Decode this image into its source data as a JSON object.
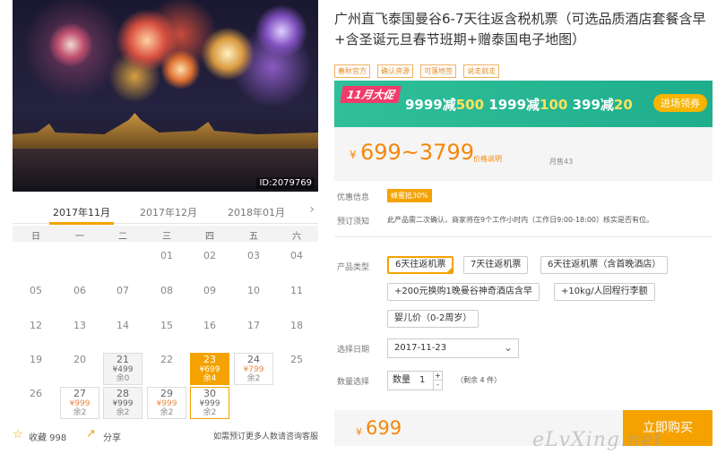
{
  "hero": {
    "image_id": "ID:2079769"
  },
  "calendar": {
    "months": [
      "2017年11月",
      "2017年12月",
      "2018年01月"
    ],
    "active_month": 0,
    "next_icon": "chevron-right-icon",
    "weekdays": [
      "日",
      "一",
      "二",
      "三",
      "四",
      "五",
      "六"
    ],
    "days": [
      {
        "n": "01",
        "col": 3,
        "row": 0
      },
      {
        "n": "02",
        "col": 4,
        "row": 0
      },
      {
        "n": "03",
        "col": 5,
        "row": 0
      },
      {
        "n": "04",
        "col": 6,
        "row": 0
      },
      {
        "n": "05",
        "col": 0,
        "row": 1
      },
      {
        "n": "06",
        "col": 1,
        "row": 1
      },
      {
        "n": "07",
        "col": 2,
        "row": 1
      },
      {
        "n": "08",
        "col": 3,
        "row": 1
      },
      {
        "n": "09",
        "col": 4,
        "row": 1
      },
      {
        "n": "10",
        "col": 5,
        "row": 1
      },
      {
        "n": "11",
        "col": 6,
        "row": 1
      },
      {
        "n": "12",
        "col": 0,
        "row": 2
      },
      {
        "n": "13",
        "col": 1,
        "row": 2
      },
      {
        "n": "14",
        "col": 2,
        "row": 2
      },
      {
        "n": "15",
        "col": 3,
        "row": 2
      },
      {
        "n": "16",
        "col": 4,
        "row": 2
      },
      {
        "n": "17",
        "col": 5,
        "row": 2
      },
      {
        "n": "18",
        "col": 6,
        "row": 2
      },
      {
        "n": "19",
        "col": 0,
        "row": 3
      },
      {
        "n": "20",
        "col": 1,
        "row": 3
      },
      {
        "n": "21",
        "col": 2,
        "row": 3,
        "price": "¥499",
        "stock": "余0",
        "style": "gray"
      },
      {
        "n": "22",
        "col": 3,
        "row": 3
      },
      {
        "n": "23",
        "col": 4,
        "row": 3,
        "price": "¥699",
        "stock": "余4",
        "style": "selected"
      },
      {
        "n": "24",
        "col": 5,
        "row": 3,
        "price": "¥799",
        "stock": "余2",
        "style": "white"
      },
      {
        "n": "25",
        "col": 6,
        "row": 3
      },
      {
        "n": "26",
        "col": 0,
        "row": 4
      },
      {
        "n": "27",
        "col": 1,
        "row": 4,
        "price": "¥999",
        "stock": "余2",
        "style": "white"
      },
      {
        "n": "28",
        "col": 2,
        "row": 4,
        "price": "¥999",
        "stock": "余2",
        "style": "gray"
      },
      {
        "n": "29",
        "col": 3,
        "row": 4,
        "price": "¥999",
        "stock": "余2",
        "style": "white"
      },
      {
        "n": "30",
        "col": 4,
        "row": 4,
        "price": "¥999",
        "stock": "余2",
        "style": "outline"
      }
    ]
  },
  "footer_left": {
    "favorite_label": "收藏 998",
    "share_label": "分享",
    "tip": "如需预订更多人数请咨询客服"
  },
  "product": {
    "title": "广州直飞泰国曼谷6-7天往返含税机票（可选品质酒店套餐含早+含圣诞元旦春节班期+赠泰国电子地图）",
    "tags": [
      "春秋官方",
      "确认资源",
      "可落地签",
      "说走就走"
    ]
  },
  "promo": {
    "badge": "11月大促",
    "deals": [
      {
        "a": "9999减",
        "b": "500"
      },
      {
        "a": "1999减",
        "b": "100"
      },
      {
        "a": "399减",
        "b": "20"
      }
    ],
    "cta": "进场领券"
  },
  "price": {
    "currency": "¥",
    "range": "699~3799",
    "note": "价格说明",
    "sold": "月售43"
  },
  "info": {
    "discount_label": "优惠信息",
    "discount_value": "蜂蜜抵30%",
    "notice_label": "预订须知",
    "notice_text": "此产品需二次确认，商家将在9个工作小时内（工作日9:00-18:00）核实是否有位。"
  },
  "options": {
    "label": "产品类型",
    "items": [
      "6天往返机票",
      "7天往返机票",
      "6天往返机票（含首晚酒店）",
      "+200元换购1晚曼谷神奇酒店含早",
      "+10kg/人回程行李额",
      "婴儿价（0-2周岁）"
    ],
    "selected_index": 0
  },
  "date": {
    "label": "选择日期",
    "value": "2017-11-23"
  },
  "quantity": {
    "label": "数量选择",
    "prefix": "数量",
    "value": "1",
    "plus": "+",
    "minus": "-",
    "remain": "（剩余 4 件）"
  },
  "buy": {
    "currency": "¥",
    "price": "699",
    "button": "立即购买"
  },
  "watermark": "eLvXing.net",
  "colors": {
    "accent": "#f5a200",
    "price": "#f5870a",
    "promo_bg": "#2fbf9a"
  }
}
